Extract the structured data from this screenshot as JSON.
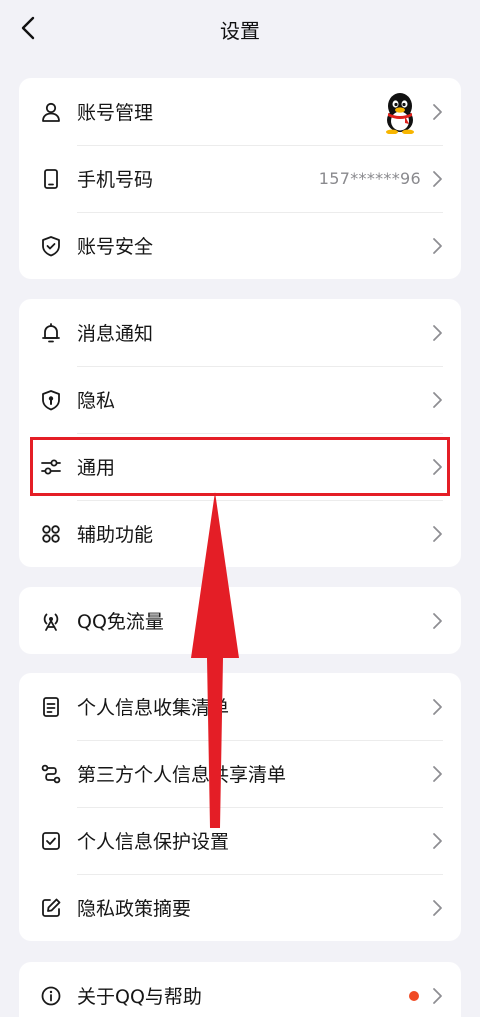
{
  "header": {
    "title": "设置"
  },
  "groups": [
    {
      "items": [
        {
          "label": "账号管理",
          "icon": "person-icon",
          "has_avatar": true
        },
        {
          "label": "手机号码",
          "icon": "phone-icon",
          "value": "157******96"
        },
        {
          "label": "账号安全",
          "icon": "shield-check-icon"
        }
      ]
    },
    {
      "items": [
        {
          "label": "消息通知",
          "icon": "bell-icon"
        },
        {
          "label": "隐私",
          "icon": "shield-lock-icon"
        },
        {
          "label": "通用",
          "icon": "sliders-icon",
          "highlighted": true
        },
        {
          "label": "辅助功能",
          "icon": "grid-circles-icon"
        }
      ]
    },
    {
      "items": [
        {
          "label": "QQ免流量",
          "icon": "antenna-icon"
        }
      ]
    },
    {
      "items": [
        {
          "label": "个人信息收集清单",
          "icon": "document-icon"
        },
        {
          "label": "第三方个人信息共享清单",
          "icon": "share-nodes-icon"
        },
        {
          "label": "个人信息保护设置",
          "icon": "checkbox-icon"
        },
        {
          "label": "隐私政策摘要",
          "icon": "edit-icon"
        }
      ]
    },
    {
      "items": [
        {
          "label": "关于QQ与帮助",
          "icon": "info-icon",
          "has_badge": true
        }
      ]
    }
  ],
  "annotation": {
    "color": "#E41E26"
  }
}
